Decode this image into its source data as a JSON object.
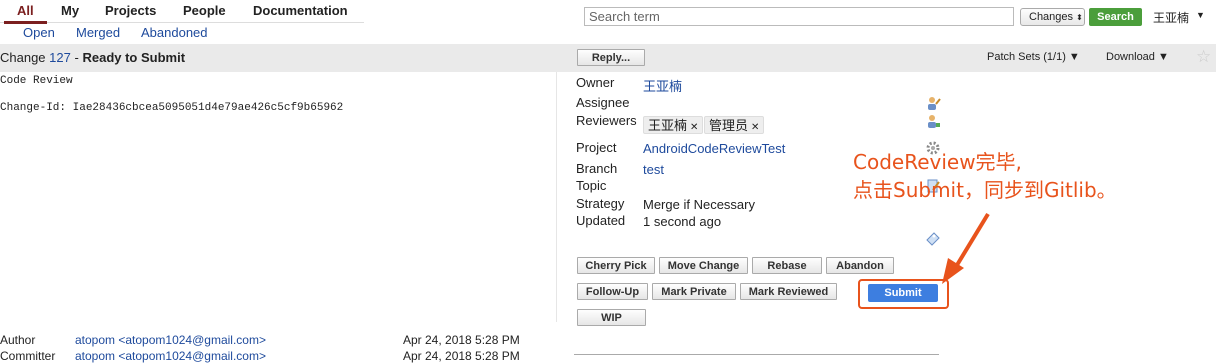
{
  "nav": {
    "tabs": [
      "All",
      "My",
      "Projects",
      "People",
      "Documentation"
    ],
    "subtabs": [
      "Open",
      "Merged",
      "Abandoned"
    ]
  },
  "search": {
    "placeholder": "Search term",
    "scope": "Changes",
    "button": "Search"
  },
  "user": {
    "name": "王亚楠"
  },
  "change": {
    "label": "Change",
    "number": "127",
    "sep": "-",
    "status": "Ready to Submit",
    "reply": "Reply...",
    "patch_sets": "Patch Sets (1/1) ▼",
    "download": "Download ▼"
  },
  "message": {
    "line1": "Code Review",
    "line2": "Change-Id: Iae28436cbcea5095051d4e79ae426c5cf9b65962"
  },
  "info": {
    "owner_label": "Owner",
    "owner": "王亚楠",
    "assignee_label": "Assignee",
    "reviewers_label": "Reviewers",
    "reviewers": [
      "王亚楠",
      "管理员"
    ],
    "project_label": "Project",
    "project": "AndroidCodeReviewTest",
    "branch_label": "Branch",
    "branch": "test",
    "topic_label": "Topic",
    "strategy_label": "Strategy",
    "strategy": "Merge if Necessary",
    "updated_label": "Updated",
    "updated": "1 second ago"
  },
  "actions": {
    "cherry_pick": "Cherry Pick",
    "move_change": "Move Change",
    "rebase": "Rebase",
    "abandon": "Abandon",
    "follow_up": "Follow-Up",
    "mark_private": "Mark Private",
    "mark_reviewed": "Mark Reviewed",
    "submit": "Submit",
    "wip": "WIP"
  },
  "annotation": {
    "line1": "CodeReview完毕,",
    "line2": "点击Submit，同步到Gitlib。",
    "color": "#e8531c"
  },
  "commit": {
    "author_label": "Author",
    "author": "atopom <atopom1024@gmail.com>",
    "author_date": "Apr 24, 2018 5:28 PM",
    "committer_label": "Committer",
    "committer": "atopom <atopom1024@gmail.com>",
    "committer_date": "Apr 24, 2018 5:28 PM"
  }
}
